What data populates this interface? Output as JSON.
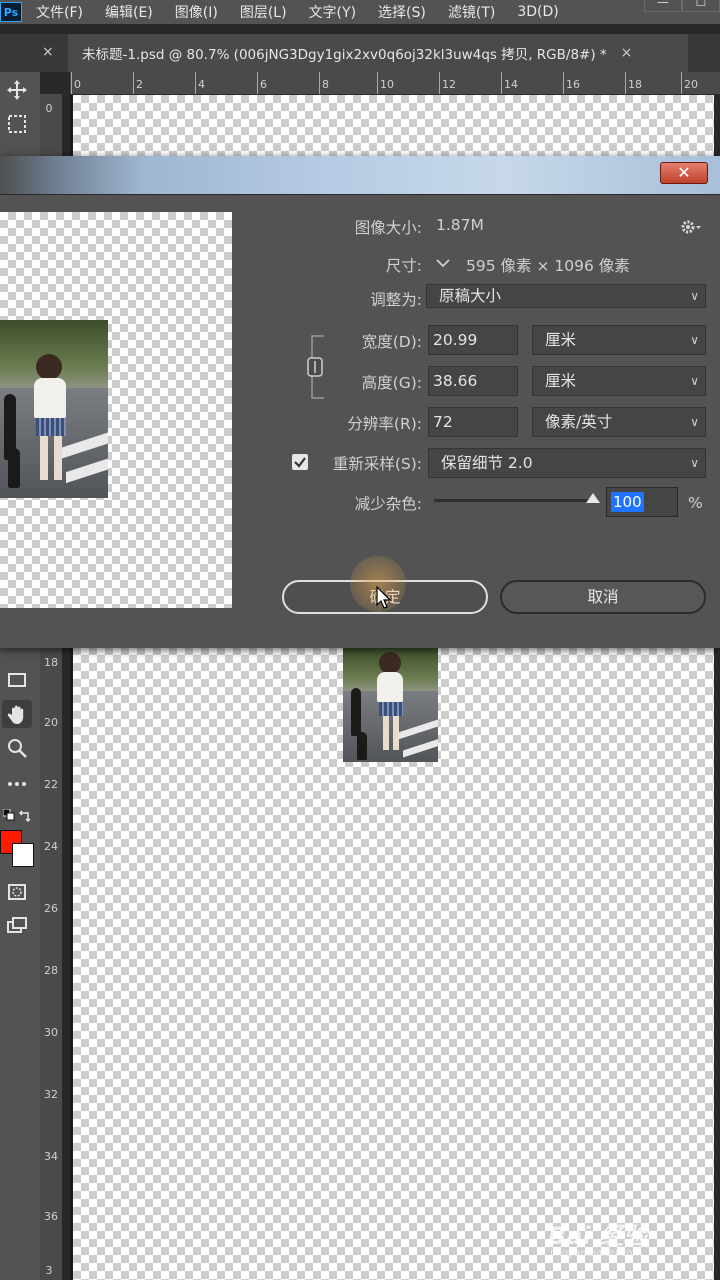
{
  "app": {
    "logo": "Ps"
  },
  "menu": [
    "文件(F)",
    "编辑(E)",
    "图像(I)",
    "图层(L)",
    "文字(Y)",
    "选择(S)",
    "滤镜(T)",
    "3D(D)"
  ],
  "window_controls": {
    "minimize": "—",
    "maximize": "☐"
  },
  "tab": {
    "title": "未标题-1.psd @ 80.7% (006jNG3Dgy1gix2xv0q6oj32kl3uw4qs 拷贝, RGB/8#) *",
    "close": "×"
  },
  "ruler_h": [
    "0",
    "2",
    "4",
    "6",
    "8",
    "10",
    "12",
    "14",
    "16",
    "18",
    "20"
  ],
  "ruler_v": [
    "0",
    "18",
    "20",
    "22",
    "24",
    "26",
    "28",
    "30",
    "32",
    "34",
    "36",
    "3"
  ],
  "dialog": {
    "close": "✕",
    "image_size_label": "图像大小:",
    "image_size_value": "1.87M",
    "dimensions_label": "尺寸:",
    "dimensions_value": "595 像素 × 1096 像素",
    "fit_to_label": "调整为:",
    "fit_to_value": "原稿大小",
    "width_label": "宽度(D):",
    "width_value": "20.99",
    "width_unit": "厘米",
    "height_label": "高度(G):",
    "height_value": "38.66",
    "height_unit": "厘米",
    "resolution_label": "分辨率(R):",
    "resolution_value": "72",
    "resolution_unit": "像素/英寸",
    "resample_label": "重新采样(S):",
    "resample_checked": true,
    "resample_value": "保留细节 2.0",
    "noise_label": "减少杂色:",
    "noise_value": "100",
    "noise_unit": "%",
    "ok_label": "确定",
    "cancel_label": "取消"
  },
  "watermark": {
    "text": "Bai 经验",
    "sub": "jingyan.baidu.com"
  },
  "colors": {
    "foreground": "#ff1a00",
    "background": "#ffffff",
    "accent": "#1f73ff"
  }
}
